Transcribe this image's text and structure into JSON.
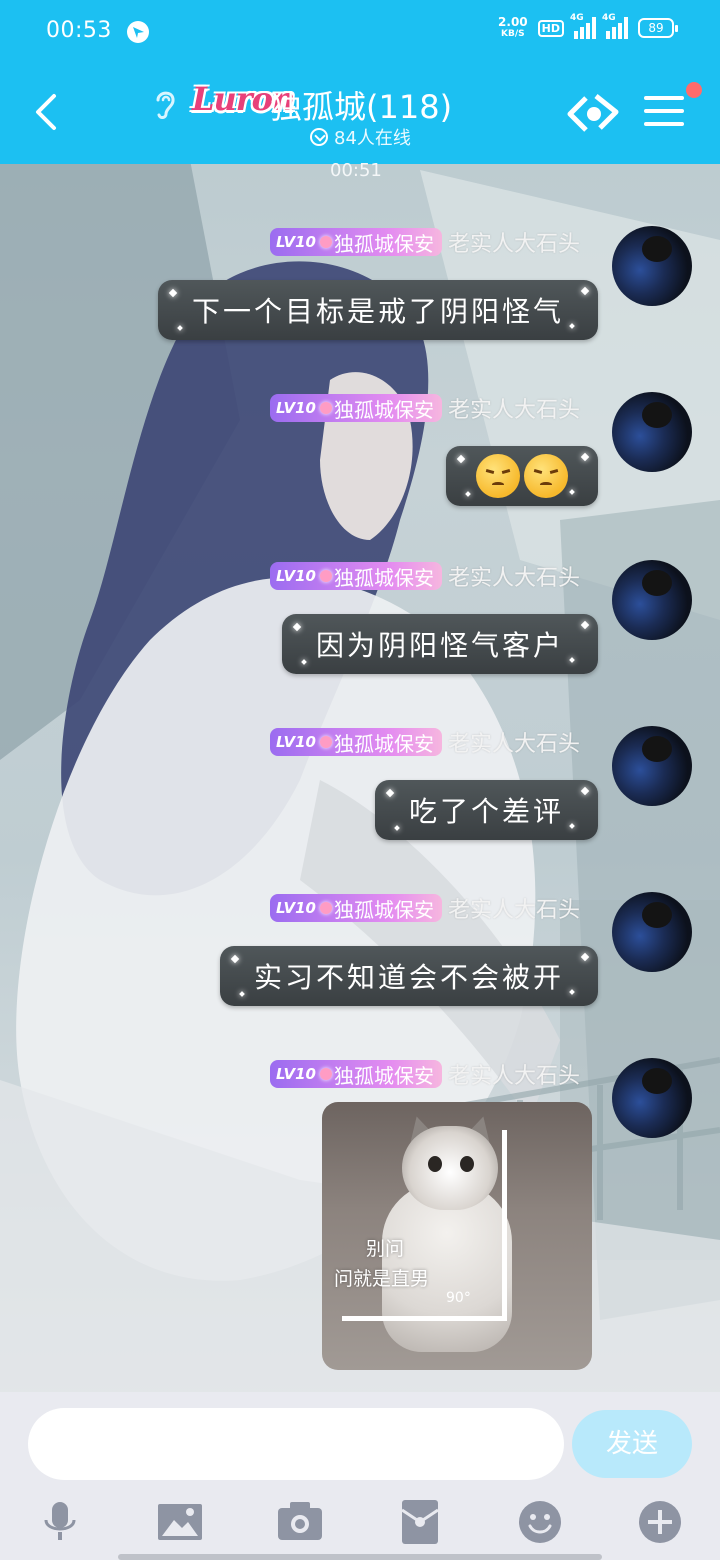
{
  "status_bar": {
    "time": "00:53",
    "speed_value": "2.00",
    "speed_unit": "KB/S",
    "hd": "HD",
    "net1": "4G",
    "net2": "4G",
    "battery": "89"
  },
  "header": {
    "brand": "Luron",
    "title": "独孤城(118)",
    "online": "84人在线"
  },
  "chat": {
    "timestamp": "00:51",
    "messages": [
      {
        "level": "LV10",
        "badge": "独孤城保安",
        "nickname": "老实人大石头",
        "text": "下一个目标是戒了阴阳怪气"
      },
      {
        "level": "LV10",
        "badge": "独孤城保安",
        "nickname": "老实人大石头",
        "emoji": [
          "angry-face",
          "angry-face"
        ]
      },
      {
        "level": "LV10",
        "badge": "独孤城保安",
        "nickname": "老实人大石头",
        "text": "因为阴阳怪气客户"
      },
      {
        "level": "LV10",
        "badge": "独孤城保安",
        "nickname": "老实人大石头",
        "text": "吃了个差评"
      },
      {
        "level": "LV10",
        "badge": "独孤城保安",
        "nickname": "老实人大石头",
        "text": "实习不知道会不会被开"
      },
      {
        "level": "LV10",
        "badge": "独孤城保安",
        "nickname": "老实人大石头",
        "image": {
          "line1": "别问",
          "line2": "问就是直男",
          "angle": "90°"
        }
      }
    ]
  },
  "input": {
    "value": "",
    "send_label": "发送"
  },
  "toolbar": {
    "icons": [
      "microphone-icon",
      "image-icon",
      "camera-icon",
      "red-packet-icon",
      "emoji-icon",
      "plus-icon"
    ]
  },
  "colors": {
    "header": "#1cc0f2",
    "bubble": "#3f4548",
    "send_disabled": "#b8e9fb",
    "badge_start": "#9b6cf0",
    "badge_end": "#f6b6df"
  }
}
